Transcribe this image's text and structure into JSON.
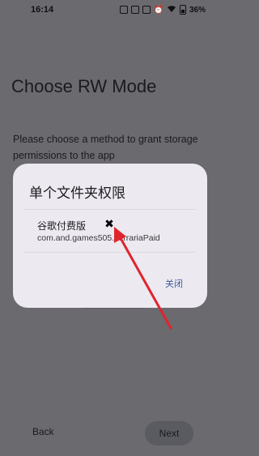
{
  "status_bar": {
    "time": "16:14",
    "battery": "36%",
    "icons": [
      "nfc-icon",
      "mute-icon",
      "close-box-icon",
      "alarm-icon",
      "wifi-icon",
      "battery-icon"
    ]
  },
  "page": {
    "title": "Choose RW Mode",
    "description": "Please choose a method to grant storage permissions to the app"
  },
  "dialog": {
    "title": "单个文件夹权限",
    "item": {
      "name": "谷歌付费版",
      "package": "com.and.games505.TerrariaPaid",
      "remove_icon": "close-icon"
    },
    "close_label": "关闭"
  },
  "annotation": {
    "color": "#e0242c",
    "icon": "red-arrow-icon"
  },
  "footer": {
    "back_label": "Back",
    "next_label": "Next"
  }
}
